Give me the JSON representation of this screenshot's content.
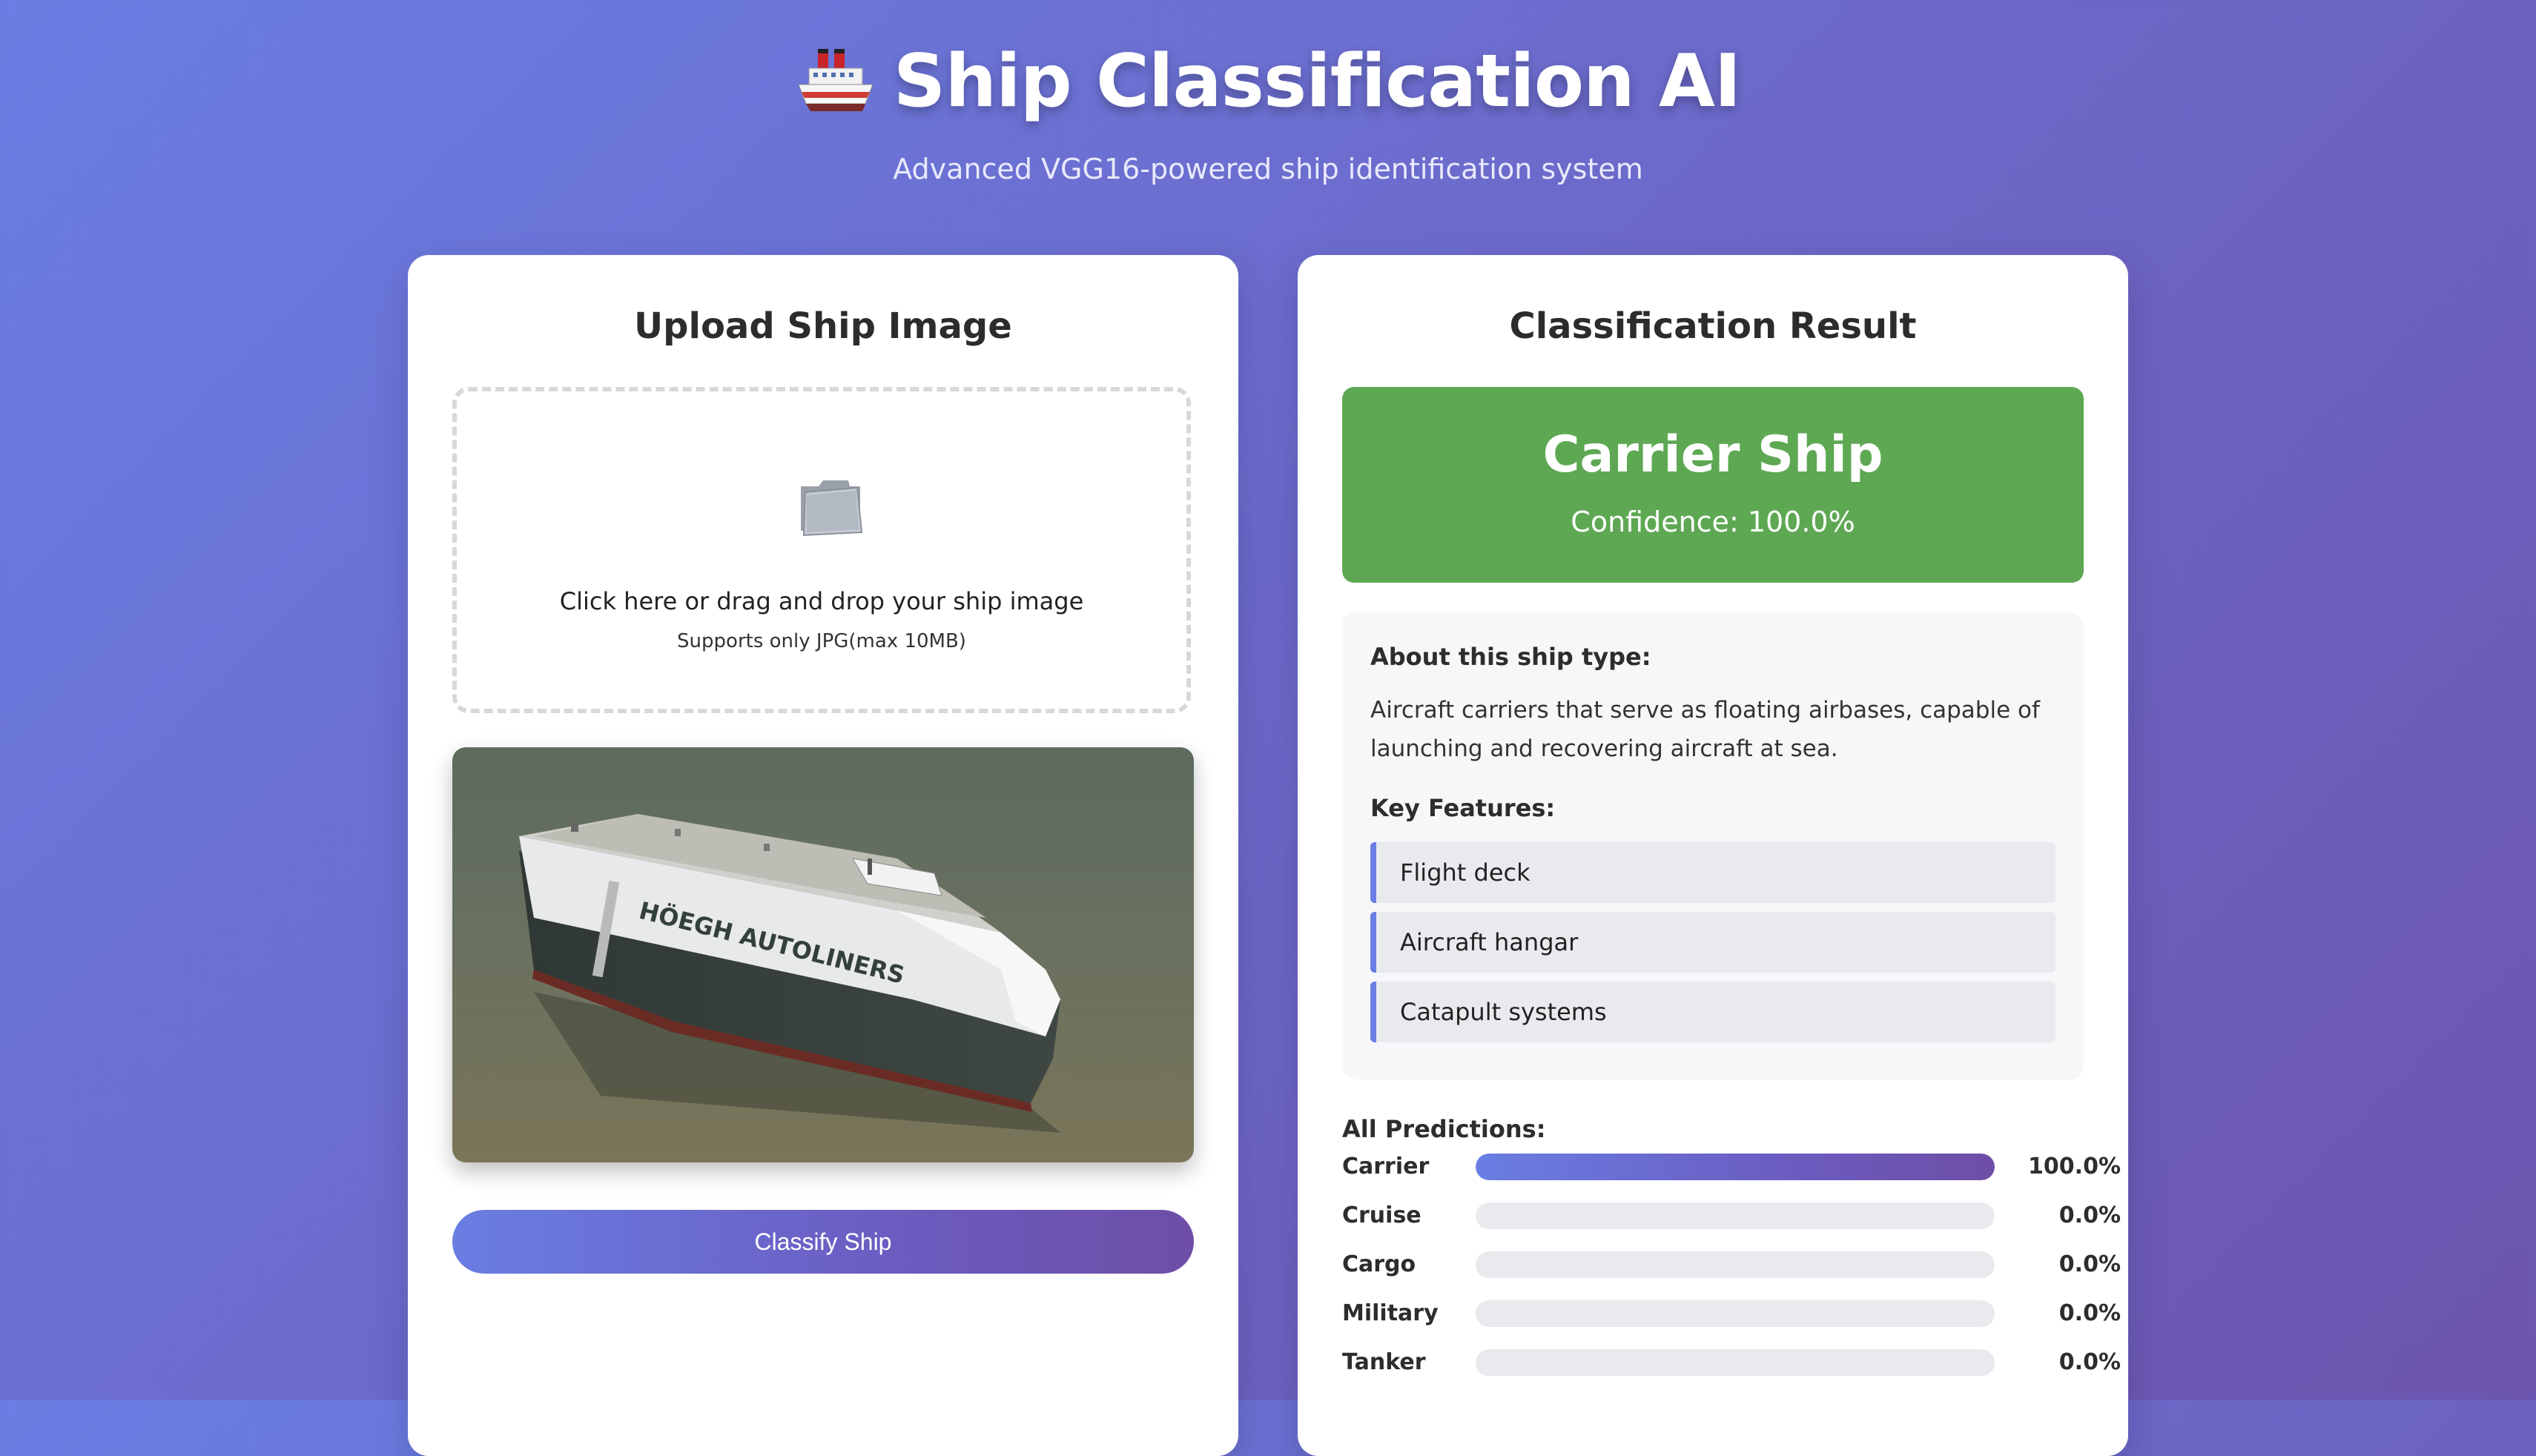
{
  "header": {
    "ship_emoji_icon": "passenger-ship-icon",
    "title": "Ship Classification AI",
    "subtitle": "Advanced VGG16-powered ship identification system"
  },
  "upload": {
    "title": "Upload Ship Image",
    "drop_icon": "folder-icon",
    "drop_text": "Click here or drag and drop your ship image",
    "drop_sub": "Supports only JPG(max 10MB)",
    "preview_ship_text": "HÖEGH AUTOLINERS",
    "classify_label": "Classify Ship"
  },
  "result": {
    "title": "Classification Result",
    "prediction": "Carrier Ship",
    "confidence": "Confidence: 100.0%",
    "result_color": "#5ea853",
    "about_title": "About this ship type:",
    "about_text": "Aircraft carriers that serve as floating airbases, capable of launching and recovering aircraft at sea.",
    "features_title": "Key Features:",
    "features": [
      "Flight deck",
      "Aircraft hangar",
      "Catapult systems"
    ],
    "predictions_title": "All Predictions:",
    "predictions": [
      {
        "label": "Carrier",
        "value": "100.0%",
        "fraction": 1.0
      },
      {
        "label": "Cruise",
        "value": "0.0%",
        "fraction": 0.0
      },
      {
        "label": "Cargo",
        "value": "0.0%",
        "fraction": 0.0
      },
      {
        "label": "Military",
        "value": "0.0%",
        "fraction": 0.0
      },
      {
        "label": "Tanker",
        "value": "0.0%",
        "fraction": 0.0
      }
    ]
  },
  "colors": {
    "accent_start": "#6a7ee3",
    "accent_end": "#6e4ea6"
  }
}
